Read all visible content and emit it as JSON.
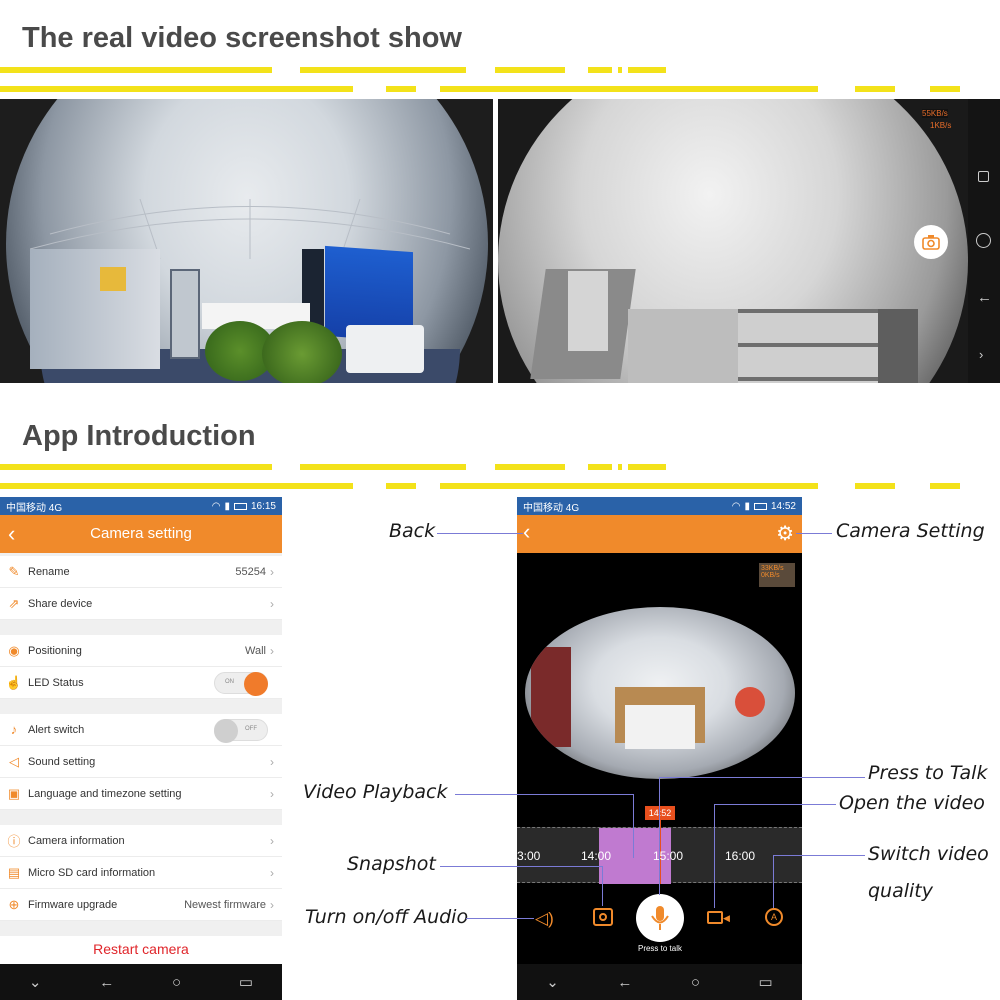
{
  "sections": {
    "screenshot_title": "The real video screenshot show",
    "app_title": "App Introduction"
  },
  "right_photo": {
    "speed1": "55KB/s",
    "speed2": "1KB/s"
  },
  "phone1": {
    "carrier": "中国移动 4G",
    "time": "16:15",
    "title": "Camera setting",
    "back": "‹",
    "rows": {
      "rename": {
        "label": "Rename",
        "value": "55254"
      },
      "share": {
        "label": "Share device"
      },
      "positioning": {
        "label": "Positioning",
        "value": "Wall"
      },
      "led": {
        "label": "LED Status",
        "toggle_text": "ON"
      },
      "alert": {
        "label": "Alert switch",
        "toggle_text": "OFF"
      },
      "sound": {
        "label": "Sound setting"
      },
      "language": {
        "label": "Language and timezone setting"
      },
      "camera_info": {
        "label": "Camera information"
      },
      "sd": {
        "label": "Micro SD card information"
      },
      "firmware": {
        "label": "Firmware upgrade",
        "value": "Newest firmware"
      }
    },
    "restart": "Restart camera"
  },
  "phone2": {
    "carrier": "中国移动 4G",
    "time": "14:52",
    "speed1": "33KB/s",
    "speed2": "0KB/s",
    "time_marker": "14:52",
    "timeline": [
      "3:00",
      "14:00",
      "15:00",
      "16:00"
    ],
    "press_to_talk": "Press to talk"
  },
  "annotations": {
    "back": "Back",
    "camera_setting": "Camera Setting",
    "video_playback": "Video Playback",
    "press_to_talk": "Press to Talk",
    "open_video": "Open the video",
    "snapshot": "Snapshot",
    "switch_quality_1": "Switch video",
    "switch_quality_2": "quality",
    "audio": "Turn on/off Audio"
  },
  "colors": {
    "accent_yellow": "#f3e21a",
    "orange": "#f08a2b",
    "status_blue": "#2a62a8",
    "restart_red": "#e0252a",
    "playback_purple": "#c07ad0"
  }
}
